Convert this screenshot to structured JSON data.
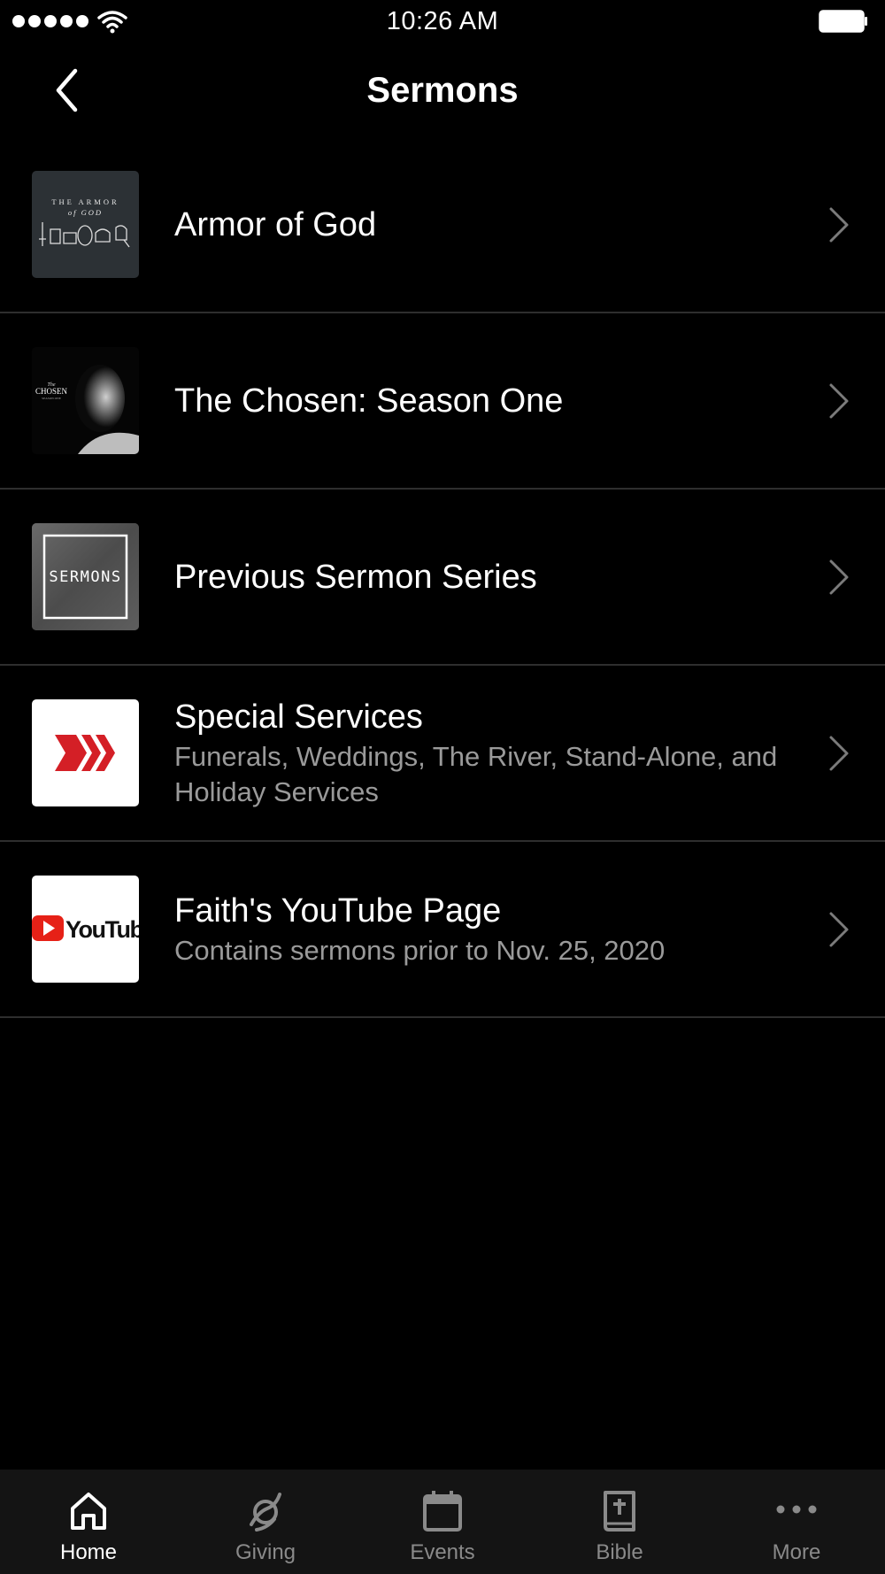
{
  "status_bar": {
    "time": "10:26 AM"
  },
  "nav": {
    "title": "Sermons"
  },
  "rows": [
    {
      "title": "Armor of God",
      "subtitle": "",
      "thumb_text": [
        "THE ARMOR",
        "of GOD"
      ]
    },
    {
      "title": "The Chosen: Season One",
      "subtitle": "",
      "thumb_text": [
        "The",
        "CHOSEN",
        "SEASON ONE"
      ]
    },
    {
      "title": "Previous Sermon Series",
      "subtitle": "",
      "thumb_text": [
        "SERMONS"
      ]
    },
    {
      "title": "Special Services",
      "subtitle": "Funerals, Weddings, The River, Stand-Alone, and Holiday Services",
      "thumb_text": []
    },
    {
      "title": "Faith's YouTube Page",
      "subtitle": "Contains sermons prior to Nov. 25, 2020",
      "thumb_text": [
        "YouTube"
      ]
    }
  ],
  "tabs": [
    {
      "label": "Home",
      "icon": "home-icon",
      "active": true
    },
    {
      "label": "Giving",
      "icon": "giving-icon",
      "active": false
    },
    {
      "label": "Events",
      "icon": "calendar-icon",
      "active": false
    },
    {
      "label": "Bible",
      "icon": "bible-icon",
      "active": false
    },
    {
      "label": "More",
      "icon": "more-icon",
      "active": false
    }
  ],
  "colors": {
    "background": "#000000",
    "tab_bar": "#141414",
    "divider": "#2e2e2e",
    "subtitle": "#9a9a9a",
    "tab_inactive": "#8a8a8a",
    "brand_red": "#d41f26"
  }
}
